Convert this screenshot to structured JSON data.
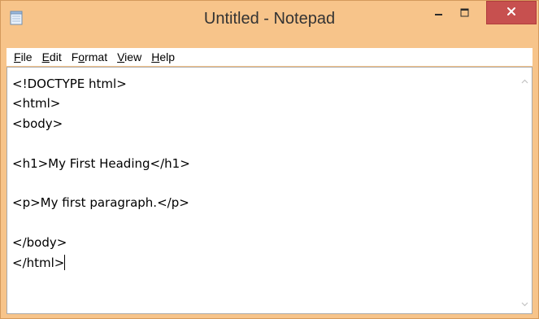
{
  "window": {
    "title": "Untitled - Notepad",
    "accent_color": "#f7c48a",
    "close_color": "#c7504f"
  },
  "titlebar": {
    "app_icon": "notepad-icon",
    "minimize_icon": "minimize-icon",
    "maximize_icon": "maximize-icon",
    "close_icon": "close-icon"
  },
  "menu": {
    "items": [
      {
        "key": "F",
        "rest": "ile"
      },
      {
        "key": "E",
        "rest": "dit"
      },
      {
        "pre": "F",
        "key": "o",
        "rest": "rmat"
      },
      {
        "key": "V",
        "rest": "iew"
      },
      {
        "key": "H",
        "rest": "elp"
      }
    ]
  },
  "editor": {
    "lines": [
      "<!DOCTYPE html>",
      "<html>",
      "<body>",
      "",
      "<h1>My First Heading</h1>",
      "",
      "<p>My first paragraph.</p>",
      "",
      "</body>",
      "</html>"
    ]
  },
  "scrollbar": {
    "up_icon": "chevron-up-icon",
    "down_icon": "chevron-down-icon"
  }
}
